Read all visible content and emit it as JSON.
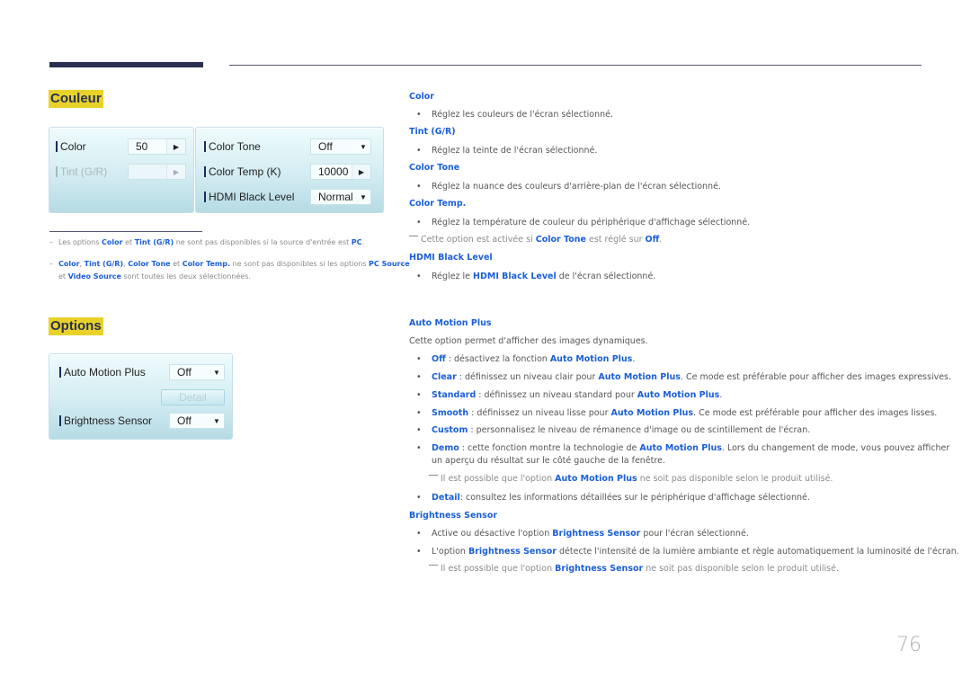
{
  "couleur": {
    "title": "Couleur",
    "left_panel": {
      "color_label": "Color",
      "color_value": "50",
      "tint_label": "Tint (G/R)",
      "tint_value": ""
    },
    "right_panel": {
      "color_tone_label": "Color Tone",
      "color_tone_value": "Off",
      "color_temp_label": "Color Temp (K)",
      "color_temp_value": "10000",
      "hdmi_label": "HDMI Black Level",
      "hdmi_value": "Normal"
    },
    "notes": [
      {
        "parts": [
          "Les options ",
          "Color",
          " et ",
          "Tint (G/R)",
          " ne sont pas disponibles si la source d'entrée est ",
          "PC",
          "."
        ]
      },
      {
        "parts": [
          "Color",
          ", ",
          "Tint (G/R)",
          ", ",
          "Color Tone",
          " et ",
          "Color Temp.",
          " ne sont pas disponibles si les options ",
          "PC Source"
        ],
        "line2": [
          "et ",
          "Video Source",
          " sont toutes les deux sélectionnées."
        ]
      }
    ]
  },
  "options": {
    "title": "Options",
    "auto_motion_label": "Auto Motion Plus",
    "auto_motion_value": "Off",
    "detail_button": "Detail",
    "brightness_label": "Brightness Sensor",
    "brightness_value": "Off"
  },
  "descriptions": {
    "color": {
      "heading": "Color",
      "bullet": "Réglez les couleurs de l'écran sélectionné."
    },
    "tint": {
      "heading": "Tint (G/R)",
      "bullet": "Réglez la teinte de l'écran sélectionné."
    },
    "color_tone": {
      "heading": "Color Tone",
      "bullet": "Réglez la nuance des couleurs d'arrière-plan de l'écran sélectionné."
    },
    "color_temp": {
      "heading": "Color Temp.",
      "bullet": "Réglez la température de couleur du périphérique d'affichage sélectionné.",
      "note": [
        "Cette option est activée si ",
        "Color Tone",
        " est réglé sur ",
        "Off",
        "."
      ]
    },
    "hdmi": {
      "heading": "HDMI Black Level",
      "bullet": [
        "Réglez le ",
        "HDMI Black Level",
        " de l'écran sélectionné."
      ]
    },
    "auto_motion": {
      "heading": "Auto Motion Plus",
      "intro": "Cette option permet d'afficher des images dynamiques.",
      "bullets": [
        [
          "Off",
          " : désactivez la fonction ",
          "Auto Motion Plus",
          "."
        ],
        [
          "Clear",
          " : définissez un niveau clair pour ",
          "Auto Motion Plus",
          ". Ce mode est préférable pour afficher des images expressives."
        ],
        [
          "Standard",
          " : définissez un niveau standard pour ",
          "Auto Motion Plus",
          "."
        ],
        [
          "Smooth",
          " : définissez un niveau lisse pour ",
          "Auto Motion Plus",
          ". Ce mode est préférable pour afficher des images lisses."
        ],
        [
          "Custom",
          " : personnalisez le niveau de rémanence d'image ou de scintillement de l'écran."
        ],
        [
          "Demo",
          " : cette fonction montre la technologie de ",
          "Auto Motion Plus",
          ". Lors du changement de mode, vous pouvez afficher"
        ]
      ],
      "demo_line2": "un aperçu du résultat sur le côté gauche de la fenêtre.",
      "note": [
        "Il est possible que l'option ",
        "Auto Motion Plus",
        " ne soit pas disponible selon le produit utilisé."
      ],
      "detail_bullet": [
        "Detail",
        ": consultez les informations détaillées sur le périphérique d'affichage sélectionné."
      ]
    },
    "brightness": {
      "heading": "Brightness Sensor",
      "bullets": [
        [
          "Active ou désactive l'option ",
          "Brightness Sensor",
          " pour l'écran sélectionné."
        ],
        [
          "L'option ",
          "Brightness Sensor",
          " détecte l'intensité de la lumière ambiante et règle automatiquement la luminosité de l'écran."
        ]
      ],
      "note": [
        "Il est possible que l'option ",
        "Brightness Sensor",
        " ne soit pas disponible selon le produit utilisé."
      ]
    }
  },
  "page_number": "76",
  "colors": {
    "accent": "#1a5fd6",
    "title_highlight": "#e8d22a",
    "header_bar": "#2a3050"
  }
}
